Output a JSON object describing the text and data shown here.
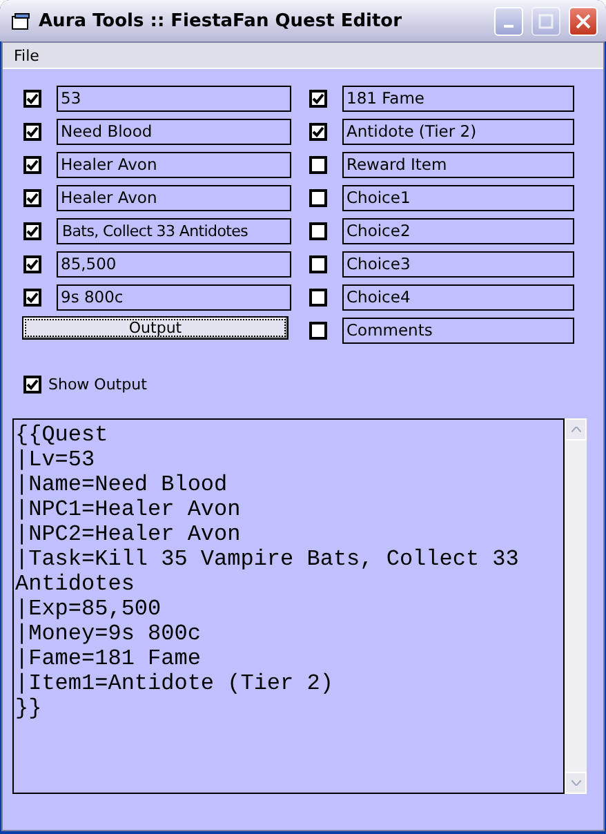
{
  "window": {
    "title": "Aura Tools :: FiestaFan Quest Editor"
  },
  "menu": [
    "File"
  ],
  "left_fields": [
    {
      "checked": true,
      "value": "53"
    },
    {
      "checked": true,
      "value": "Need Blood"
    },
    {
      "checked": true,
      "value": "Healer Avon"
    },
    {
      "checked": true,
      "value": "Healer Avon"
    },
    {
      "checked": true,
      "value": "Bats, Collect 33 Antidotes"
    },
    {
      "checked": true,
      "value": "85,500"
    },
    {
      "checked": true,
      "value": "9s 800c"
    }
  ],
  "right_fields": [
    {
      "checked": true,
      "value": "181 Fame"
    },
    {
      "checked": true,
      "value": "Antidote (Tier 2)"
    },
    {
      "checked": false,
      "value": "Reward Item"
    },
    {
      "checked": false,
      "value": "Choice1"
    },
    {
      "checked": false,
      "value": "Choice2"
    },
    {
      "checked": false,
      "value": "Choice3"
    },
    {
      "checked": false,
      "value": "Choice4"
    },
    {
      "checked": false,
      "value": "Comments"
    }
  ],
  "output_button": "Output",
  "show_output": {
    "label": "Show Output",
    "checked": true
  },
  "output_lines": [
    "{{Quest",
    "|Lv=53",
    "|Name=Need Blood",
    "|NPC1=Healer Avon",
    "|NPC2=Healer Avon",
    "|Task=Kill 35 Vampire Bats, Collect 33 Antidotes",
    "|Exp=85,500",
    "|Money=9s 800c",
    "|Fame=181 Fame",
    "|Item1=Antidote (Tier 2)",
    "}}"
  ]
}
